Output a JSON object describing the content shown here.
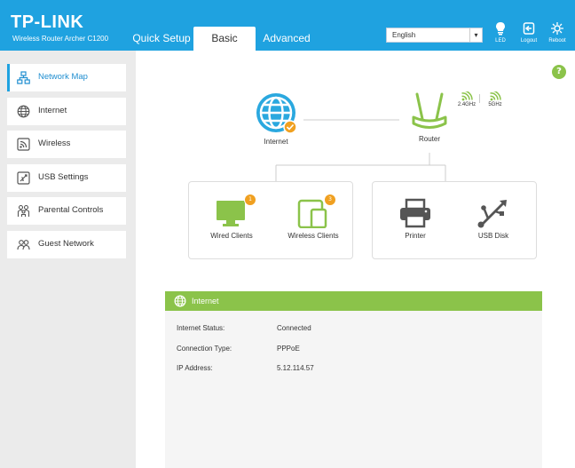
{
  "header": {
    "brand": "TP-LINK",
    "model": "Wireless Router Archer C1200",
    "tabs": [
      {
        "label": "Quick Setup"
      },
      {
        "label": "Basic"
      },
      {
        "label": "Advanced"
      }
    ],
    "language": "English",
    "buttons": [
      {
        "label": "LED",
        "icon": "bulb-icon"
      },
      {
        "label": "Logout",
        "icon": "logout-icon"
      },
      {
        "label": "Reboot",
        "icon": "reboot-icon"
      }
    ]
  },
  "sidebar": {
    "items": [
      {
        "label": "Network Map",
        "icon": "network-map-icon"
      },
      {
        "label": "Internet",
        "icon": "globe-icon"
      },
      {
        "label": "Wireless",
        "icon": "wireless-icon"
      },
      {
        "label": "USB Settings",
        "icon": "usb-settings-icon"
      },
      {
        "label": "Parental Controls",
        "icon": "parental-controls-icon"
      },
      {
        "label": "Guest Network",
        "icon": "guest-network-icon"
      }
    ]
  },
  "map": {
    "help": "?",
    "internet_label": "Internet",
    "router_label": "Router",
    "band_24": "2.4GHz",
    "band_5": "5GHz",
    "wired_clients": {
      "label": "Wired Clients",
      "count": "1"
    },
    "wireless_clients": {
      "label": "Wireless Clients",
      "count": "3"
    },
    "printer": "Printer",
    "usb_disk": "USB Disk"
  },
  "internet_panel": {
    "title": "Internet",
    "rows": [
      {
        "label": "Internet Status:",
        "value": "Connected"
      },
      {
        "label": "Connection Type:",
        "value": "PPPoE"
      },
      {
        "label": "IP Address:",
        "value": "5.12.114.57"
      }
    ]
  },
  "colors": {
    "header": "#1fa2e0",
    "accent": "#8bc34a",
    "badge": "#f0a020"
  }
}
